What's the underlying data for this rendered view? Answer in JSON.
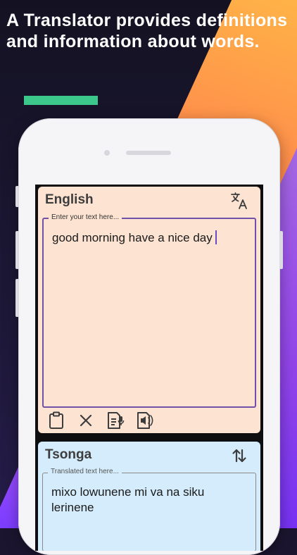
{
  "headline": "A Translator provides definitions and information about words.",
  "source": {
    "language": "English",
    "placeholder": "Enter your text here...",
    "text": "good morning have a nice day"
  },
  "target": {
    "language": "Tsonga",
    "placeholder": "Translated text here...",
    "text": "mixo lowunene mi va na siku lerinene"
  },
  "icons": {
    "translate": "translate-icon",
    "clipboard": "clipboard-icon",
    "clear": "close-icon",
    "mic": "mic-icon",
    "speaker": "speaker-icon",
    "swap": "swap-icon"
  },
  "colors": {
    "accent_green": "#3cc88a",
    "source_card": "#fde3d2",
    "target_card": "#d4ecfb",
    "focus_border": "#7050a8"
  }
}
